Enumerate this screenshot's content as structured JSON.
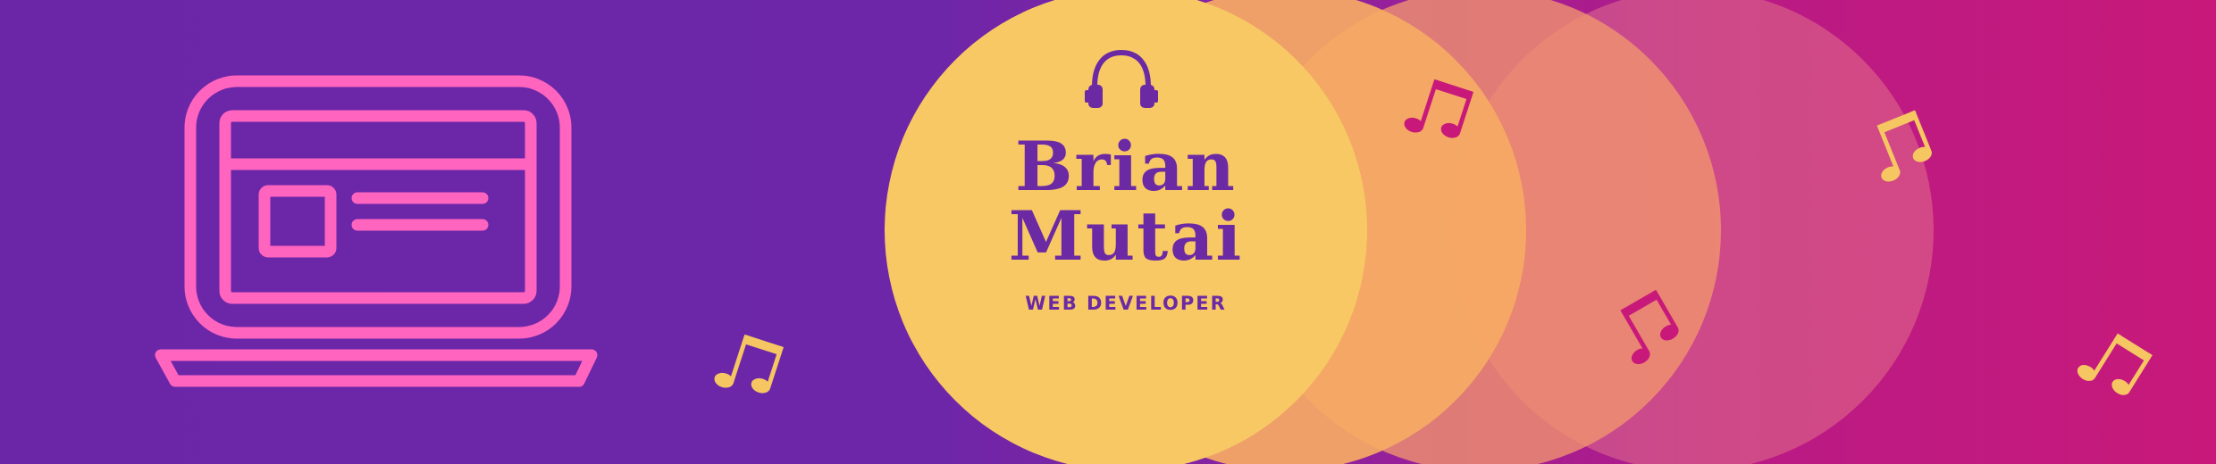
{
  "banner": {
    "name_first": "Brian",
    "name_last": "Mutai",
    "role": "WEB DEVELOPER"
  },
  "colors": {
    "background_left": "#6b26a8",
    "background_right": "#c8197a",
    "circle_primary": "#f8c865",
    "laptop_icon": "#ff64be",
    "text": "#6b2aa4",
    "note_yellow": "#f6c662",
    "note_magenta": "#c8197a"
  },
  "icons": {
    "laptop": "laptop-icon",
    "headphones": "headphones-icon",
    "music_note": "music-note-icon"
  }
}
